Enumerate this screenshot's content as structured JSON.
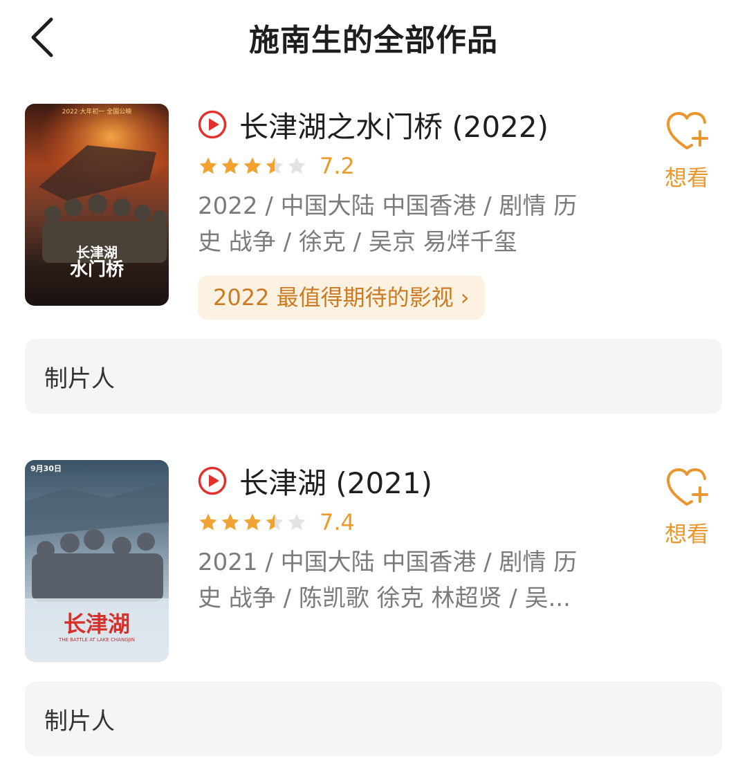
{
  "header": {
    "title": "施南生的全部作品"
  },
  "works": [
    {
      "title": "长津湖之水门桥 (2022)",
      "stars": 3.5,
      "score": "7.2",
      "meta_line1": "2022 / 中国大陆 中国香港 / 剧情 历",
      "meta_line2": "史 战争 / 徐克 / 吴京 易烊千玺",
      "ranking": "2022 最值得期待的影视 ›",
      "want_label": "想看",
      "role": "制片人",
      "poster": {
        "top_text": "2022·大年初一 全国公映",
        "big_title_1": "长津湖",
        "big_title_2": "水门桥"
      }
    },
    {
      "title": "长津湖 (2021)",
      "stars": 3.5,
      "score": "7.4",
      "meta_line1": "2021 / 中国大陆 中国香港 / 剧情 历",
      "meta_line2": "史 战争 / 陈凯歌 徐克 林超贤 / 吴...",
      "want_label": "想看",
      "role": "制片人",
      "poster": {
        "top_text": "9月30日",
        "big_title": "长津湖",
        "subtitle": "THE BATTLE AT LAKE CHANGJIN"
      }
    }
  ],
  "colors": {
    "accent": "#e9962c",
    "play_red": "#e2302c",
    "rank_bg": "#fdf1e1"
  }
}
